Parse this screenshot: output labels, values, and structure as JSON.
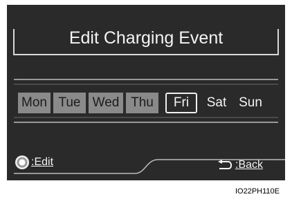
{
  "screen": {
    "title": "Edit Charging Event",
    "days": [
      {
        "label": "Mon",
        "state": "active"
      },
      {
        "label": "Tue",
        "state": "active"
      },
      {
        "label": "Wed",
        "state": "active"
      },
      {
        "label": "Thu",
        "state": "active"
      },
      {
        "label": "Fri",
        "state": "selected"
      },
      {
        "label": "Sat",
        "state": "inactive"
      },
      {
        "label": "Sun",
        "state": "inactive"
      }
    ],
    "edit_label": ":Edit",
    "back_label": ":Back",
    "colors": {
      "background": "#2a2a2a",
      "active_day": "#8a8a8a",
      "text": "#f4f4f4"
    }
  },
  "image_code": "IO22PH110E"
}
